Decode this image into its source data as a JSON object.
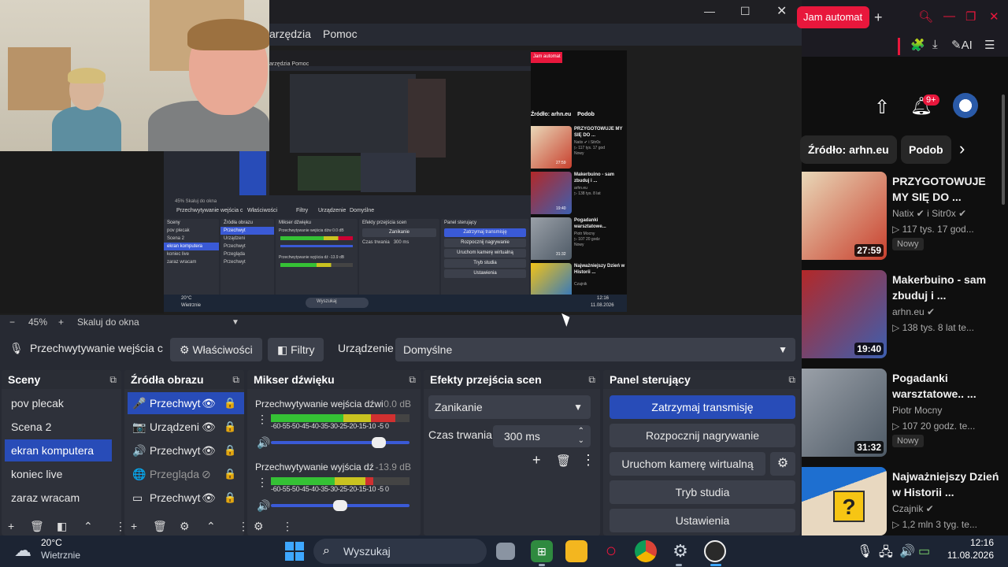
{
  "browser": {
    "tab_title": "Jam automat",
    "tab_close": "✕",
    "new_tab": "+",
    "chips": [
      "Źródło: arhn.eu",
      "Podob"
    ],
    "notif_count": "9+",
    "videos": [
      {
        "title": "PRZYGOTOWUJE MY SIĘ DO ...",
        "channel": "Natix ✔ i Sitr0x ✔",
        "stats": "▷ 117 tys.   17 god...",
        "duration": "27:59",
        "badge": "Nowy",
        "color1": "#e9d8b8",
        "color2": "#c8402e"
      },
      {
        "title": "Makerbuino - sam zbuduj i ...",
        "channel": "arhn.eu ✔",
        "stats": "▷ 138 tys.   8 lat te...",
        "duration": "19:40",
        "badge": "",
        "color1": "#b32828",
        "color2": "#3c5fb0"
      },
      {
        "title": "Pogadanki warsztatowe.. ...",
        "channel": "Piotr Mocny",
        "stats": "▷ 107   20 godz. te...",
        "duration": "31:32",
        "badge": "Nowy",
        "color1": "#9aa0a8",
        "color2": "#4e5a66"
      },
      {
        "title": "Najważniejszy Dzień w Historii ...",
        "channel": "Czajnik ✔",
        "stats": "▷ 1,2 mln   3 tyg. te...",
        "duration": "",
        "badge": "",
        "color1": "#f2c318",
        "color2": "#1e6fd0"
      }
    ]
  },
  "obs": {
    "menu": [
      "arzędzia",
      "Pomoc"
    ],
    "zoom": {
      "minus": "−",
      "percent": "45%",
      "plus": "+",
      "mode": "Skaluj do okna"
    },
    "context": {
      "source_name": "Przechwytywanie wejścia c",
      "properties": "Właściwości",
      "filters": "Filtry",
      "device_label": "Urządzenie",
      "device_value": "Domyślne"
    },
    "docks": {
      "scenes": "Sceny",
      "sources": "Źródła obrazu",
      "mixer": "Mikser dźwięku",
      "transitions": "Efekty przejścia scen",
      "controls": "Panel sterujący"
    },
    "scenes": [
      "pov plecak",
      "Scena 2",
      "ekran komputera",
      "koniec live",
      "zaraz wracam"
    ],
    "selected_scene": 2,
    "sources": [
      {
        "icon": "🎤",
        "name": "Przechwyt",
        "icon_name": "microphone-icon"
      },
      {
        "icon": "📷",
        "name": "Urządzeni",
        "icon_name": "camera-icon"
      },
      {
        "icon": "🔊",
        "name": "Przechwyt",
        "icon_name": "speaker-icon"
      },
      {
        "icon": "🌐",
        "name": "Przegląda",
        "icon_name": "globe-icon"
      },
      {
        "icon": "▭",
        "name": "Przechwyt",
        "icon_name": "display-icon"
      }
    ],
    "mixer": [
      {
        "name": "Przechwytywanie wejścia dźwi",
        "db": "0.0 dB",
        "level": 0.78
      },
      {
        "name": "Przechwytywanie wyjścia dź",
        "db": "-13.9 dB",
        "level": 0.5
      }
    ],
    "mixer_ticks": "-60-55-50-45-40-35-30-25-20-15-10 -5  0",
    "transition": {
      "type": "Zanikanie",
      "duration_label": "Czas trwania",
      "duration": "300 ms"
    },
    "controls": [
      "Zatrzymaj transmisję",
      "Rozpocznij nagrywanie",
      "Uruchom kamerę wirtualną",
      "Tryb studia",
      "Ustawienia"
    ]
  },
  "nested": {
    "menu": "arzędzia   Pomoc",
    "source": "Przechwytywanie wejścia c",
    "props": "Właściwości",
    "filters": "Filtry",
    "device": "Urządzenie",
    "device_val": "Domyślne",
    "zoom": "45%     Skaluj do okna",
    "scenes": [
      "pov plecak",
      "Scena 2",
      "ekran komputera",
      "koniec live",
      "zaraz wracam"
    ],
    "sources": [
      "Przechwyt",
      "Urządzeni",
      "Przechwyt",
      "Przegląda",
      "Przechwyt"
    ],
    "controls": [
      "Zatrzymaj transmisję",
      "Rozpocznij nagrywanie",
      "Uruchom kamerę wirtualną",
      "Tryb studia",
      "Ustawienia"
    ],
    "mix1": "Przechwytywanie wejścia dźw 0.0 dB",
    "mix2": "Przechwytywanie wyjścia dź -13.9 dB",
    "transition": "Zanikanie",
    "duration_label": "Czas trwania",
    "duration": "300 ms",
    "yt_tab": "Jam automat",
    "yt_chip": "Źródło: arhn.eu",
    "yt_chip2": "Podob",
    "yt_videos": [
      {
        "title": "PRZYGOTOWUJE MY SIĘ DO ...",
        "chan": "Natix ✔ i Sitr0x",
        "stats": "▷ 117 tys.  17 god",
        "badge": "Nowy",
        "duration": "27:59"
      },
      {
        "title": "Makerbuino - sam zbuduj i ...",
        "chan": "arhn.eu",
        "stats": "▷ 138 tys.  8 lat",
        "badge": "",
        "duration": "19:40"
      },
      {
        "title": "Pogadanki warsztatowe...",
        "chan": "Piotr Mocny",
        "stats": "▷ 107  20 godz",
        "badge": "Nowy",
        "duration": "31:32"
      },
      {
        "title": "Najważniejszy Dzień w Historii ...",
        "chan": "Czajnik",
        "stats": "",
        "badge": "",
        "duration": ""
      }
    ],
    "weather_temp": "20°C",
    "weather_cond": "Wietrznie",
    "search": "Wyszukaj",
    "time": "12:16",
    "date": "11.08.2026"
  },
  "taskbar": {
    "temperature": "20°C",
    "condition": "Wietrznie",
    "search_placeholder": "Wyszukaj",
    "time": "12:16",
    "date": "11.08.2026"
  },
  "colors": {
    "accent": "#284cb8",
    "youtube_red": "#e8173c",
    "obs_bg": "#272a33"
  }
}
